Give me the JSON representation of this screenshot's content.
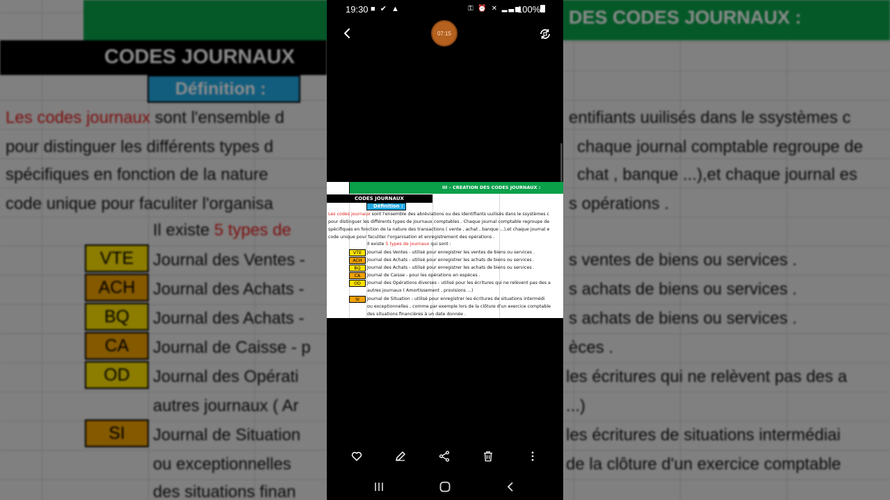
{
  "status_bar": {
    "time": "19:30",
    "battery": "100%"
  },
  "viewer": {
    "timer": "07:15"
  },
  "spreadsheet": {
    "header": "III – CREATION DES CODES JOURNAUX :",
    "title": "CODES JOURNAUX",
    "definition_label": "Définition :",
    "intro_red": "Les codes journaux",
    "intro_line1_rest": " sont l'ensemble des abréviations ou des identifiants uuilisés dans le ssystèmes c",
    "intro_line2": "pour distinguer les différents types de journaux comptables . Chaque journal comptable regroupe de",
    "intro_line3": "spécifiques en fonction de la nature des transactions ( vente , achat , banque ...),et chaque journal e",
    "intro_line4": "code unique pour faculiter l'organisation et enregistrement des opérations .",
    "count_prefix": "Il existe ",
    "count_red": "5 types de journaux",
    "count_suffix": " qui sont :",
    "journals": [
      {
        "code": "VTE",
        "desc": "Journal des Ventes - utilisé pour enregistrer les ventes de biens ou services ."
      },
      {
        "code": "ACH",
        "desc": "Journal des Achats - utilisé pour enregistrer les achats de biens ou services ."
      },
      {
        "code": "BQ",
        "desc": "Journal des Achats - utilisé pour enregistrer les achats de biens ou services ."
      },
      {
        "code": "CA",
        "desc": "Journal de Caisse - pour les opérations en espèces ."
      },
      {
        "code": "OD",
        "desc": "Journal des Opérations diverses - utilisé pour les écritures qui ne relèvent pas des a"
      },
      {
        "code": "SI",
        "desc": "Journal de Situation - utilisé pour enregistrer les écritures de situations intermédi"
      }
    ],
    "od_cont": "autres journaux ( Amortissement , provisions ...)",
    "si_cont1": "ou exceptionnelles , comme par exemple lors de la clôture d'un exercice comptable",
    "si_cont2": "des situations financières à un date donnée ."
  },
  "background": {
    "green_text": "DES CODES JOURNAUX :",
    "title": "CODES JOURNAUX",
    "definition": "Définition :",
    "l1_red": "Les codes journaux",
    "l1_rest": " sont l'ensemble d",
    "l1_right": "entifiants uuilisés dans le ssystèmes c",
    "l2_left": "pour distinguer les différents types d",
    "l2_right": "chaque journal comptable regroupe de",
    "l3_left": "spécifiques en fonction de la nature",
    "l3_right": "chat , banque ...),et chaque journal es",
    "l4_left": "code unique pour faculiter l'organisa",
    "l4_right": "s opérations .",
    "count_prefix": "Il existe ",
    "count_red": "5 types de",
    "rows": [
      {
        "code": "VTE",
        "left": "Journal des Ventes -",
        "right": "s ventes de biens ou services ."
      },
      {
        "code": "ACH",
        "left": "Journal des Achats -",
        "right": "s achats de biens ou services ."
      },
      {
        "code": "BQ",
        "left": "Journal des Achats -",
        "right": "s achats de biens ou services ."
      },
      {
        "code": "CA",
        "left": "Journal de Caisse - p",
        "right": "èces ."
      },
      {
        "code": "OD",
        "left": "Journal des Opérati",
        "right": "les écritures qui ne relèvent pas des a"
      },
      {
        "code": "SI",
        "left": "Journal de Situation",
        "right": "les écritures de situations intermédiai"
      }
    ],
    "od_cont_left": "autres journaux ( Ar",
    "od_cont_right": "...)",
    "si_cont1_left": "ou exceptionnelles",
    "si_cont1_right": "de la clôture d'un exercice comptable",
    "si_cont2_left": "des situations finan"
  },
  "icons": {
    "back": "back-arrow-icon",
    "rotate": "rotate-icon",
    "favorite": "heart-icon",
    "edit": "pencil-icon",
    "share": "share-icon",
    "delete": "trash-icon",
    "more": "more-vert-icon",
    "recents": "recents-icon",
    "home": "home-icon",
    "nav_back": "nav-back-icon"
  },
  "colors": {
    "green": "#0aa04a",
    "blue": "#22a9e4",
    "yellow": "#ffe300",
    "orange": "#f3a200",
    "red": "#e21a1a",
    "timer": "#b5611f"
  }
}
